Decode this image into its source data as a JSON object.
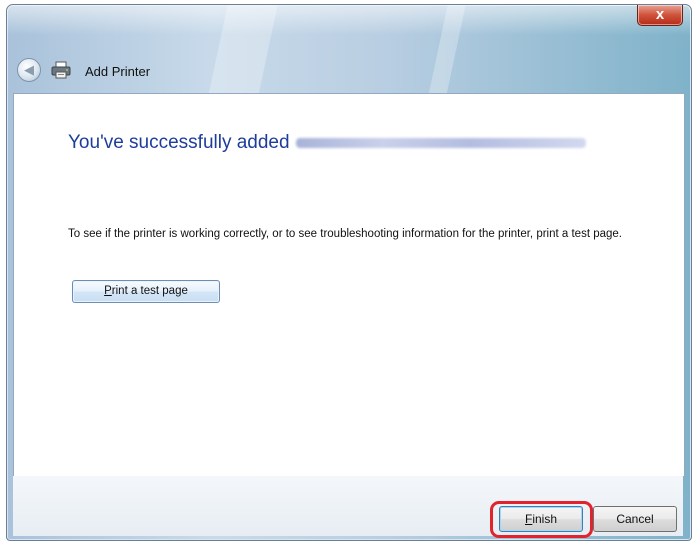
{
  "window": {
    "title": "Add Printer",
    "close_label": "x"
  },
  "content": {
    "headline": "You've successfully added",
    "info_text": "To see if the printer is working correctly, or to see troubleshooting information for the printer, print a test page.",
    "test_button": {
      "mnemonic": "P",
      "rest": "rint a test page"
    }
  },
  "footer": {
    "finish": {
      "mnemonic": "F",
      "rest": "inish"
    },
    "cancel_label": "Cancel"
  },
  "colors": {
    "headline": "#1e3d9b",
    "highlight": "#e0232c"
  },
  "icons": [
    "back-arrow-icon",
    "printer-icon",
    "close-icon"
  ]
}
